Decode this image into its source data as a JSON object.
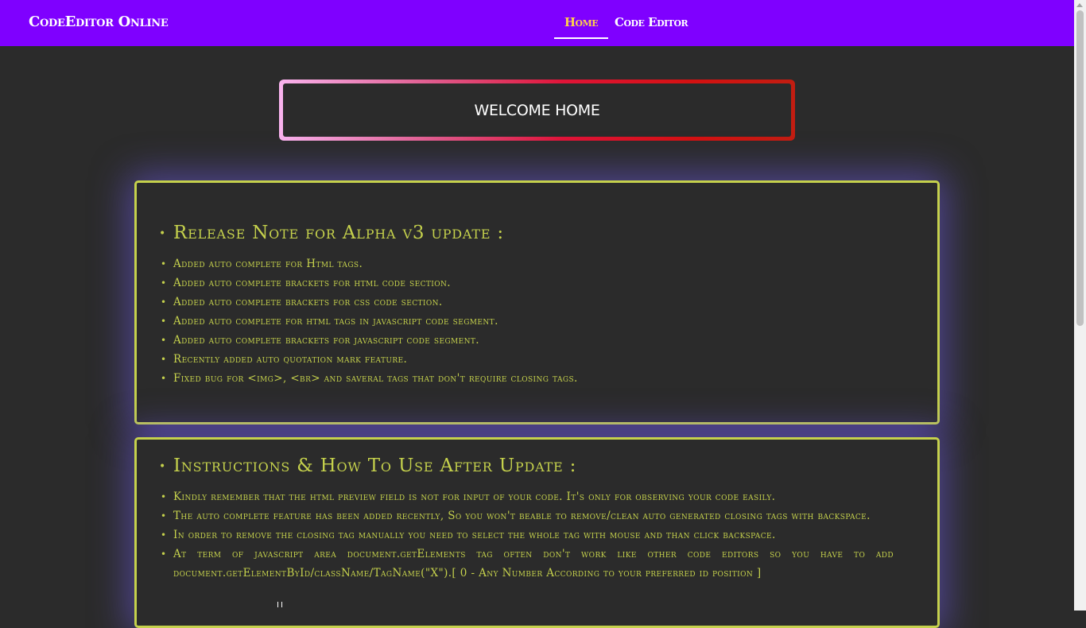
{
  "navbar": {
    "brand": "CodeEditor Online",
    "links": [
      {
        "label": "Home",
        "active": true
      },
      {
        "label": "Code Editor",
        "active": false
      }
    ],
    "bg_color": "#7f00ff",
    "active_color": "#ffd24a"
  },
  "welcome": {
    "title": "WELCOME HOME"
  },
  "release_notes": {
    "heading": "Release Note for Alpha v3 update :",
    "items": [
      "Added auto complete for Html tags.",
      "Added auto complete brackets for html code section.",
      "Added auto complete brackets for css code section.",
      "Added auto complete for html tags in javascript code segment.",
      "Added auto complete brackets for javascript code segment.",
      "Recently added auto quotation mark feature.",
      "Fixed bug for <img>, <br> and saveral tags that don't require closing tags."
    ]
  },
  "instructions": {
    "heading": "Instructions & How To Use After Update :",
    "items": [
      "Kindly remember that the html preview field is not for input of your code. It's only for observing your code easily.",
      "The auto complete feature has been added recently, So you won't beable to remove/clean auto generated closing tags with backspace.",
      "In order to remove the closing tag manually you need to select the whole tag with mouse and than click backspace.",
      "At term of javascript area document.getElements tag often don't work like other code editors so you have to add document.getElementById/className/TagName(\"X\").[ 0 - Any Number According to your preferred id position ]"
    ]
  },
  "colors": {
    "page_bg": "#2b2b2b",
    "card_text": "#c5d14c",
    "card_border": "#c5d14c",
    "card_glow": "#6e5ae6"
  }
}
